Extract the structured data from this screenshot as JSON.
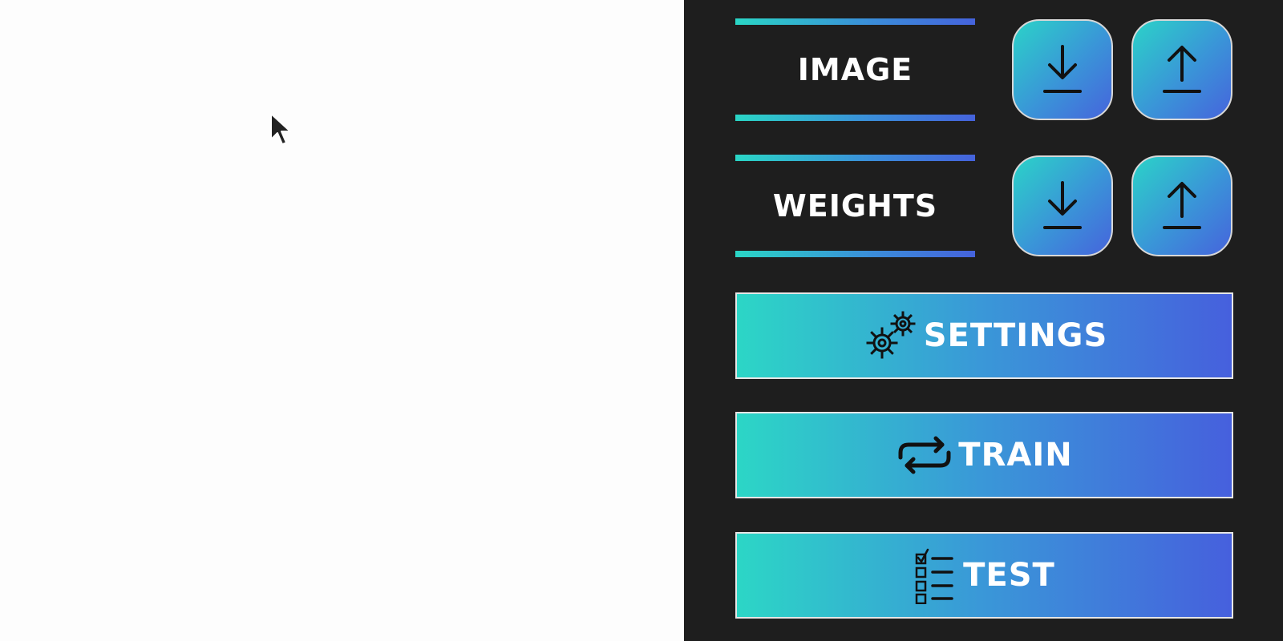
{
  "canvas": {
    "background": "#fdfdfd"
  },
  "panel": {
    "background": "#1e1e1e",
    "gradient_start": "#2cd6c6",
    "gradient_end": "#4660dd",
    "file_rows": [
      {
        "label": "IMAGE",
        "download_icon": "download-icon",
        "upload_icon": "upload-icon"
      },
      {
        "label": "WEIGHTS",
        "download_icon": "download-icon",
        "upload_icon": "upload-icon"
      }
    ],
    "actions": {
      "settings": {
        "label": "SETTINGS",
        "icon": "gears-icon"
      },
      "train": {
        "label": "TRAIN",
        "icon": "repeat-icon"
      },
      "test": {
        "label": "TEST",
        "icon": "checklist-icon"
      }
    }
  }
}
